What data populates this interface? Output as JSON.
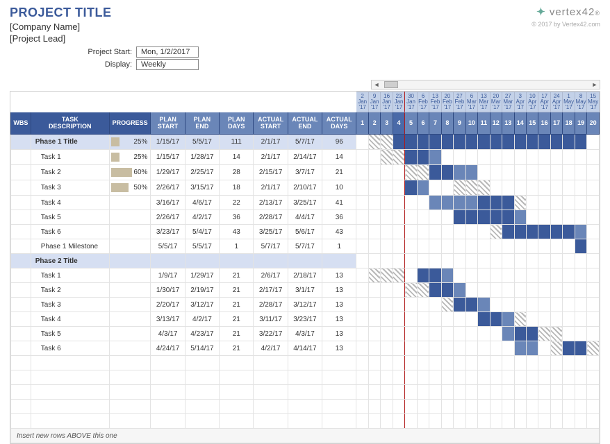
{
  "header": {
    "title": "PROJECT TITLE",
    "company": "[Company Name]",
    "lead": "[Project Lead]",
    "logo": "vertex42",
    "copyright": "© 2017 by Vertex42.com"
  },
  "controls": {
    "start_label": "Project Start:",
    "start_value": "Mon, 1/2/2017",
    "display_label": "Display:",
    "display_value": "Weekly"
  },
  "columns": {
    "wbs": "WBS",
    "task": "TASK DESCRIPTION",
    "progress": "PROGRESS",
    "pstart": "PLAN START",
    "pend": "PLAN END",
    "pdays": "PLAN DAYS",
    "astart": "ACTUAL START",
    "aend": "ACTUAL END",
    "adays": "ACTUAL DAYS"
  },
  "timeline_dates": [
    {
      "d": "2",
      "m": "Jan",
      "y": "'17"
    },
    {
      "d": "9",
      "m": "Jan",
      "y": "'17"
    },
    {
      "d": "16",
      "m": "Jan",
      "y": "'17"
    },
    {
      "d": "23",
      "m": "Jan",
      "y": "'17"
    },
    {
      "d": "30",
      "m": "Jan",
      "y": "'17"
    },
    {
      "d": "6",
      "m": "Feb",
      "y": "'17"
    },
    {
      "d": "13",
      "m": "Feb",
      "y": "'17"
    },
    {
      "d": "20",
      "m": "Feb",
      "y": "'17"
    },
    {
      "d": "27",
      "m": "Feb",
      "y": "'17"
    },
    {
      "d": "6",
      "m": "Mar",
      "y": "'17"
    },
    {
      "d": "13",
      "m": "Mar",
      "y": "'17"
    },
    {
      "d": "20",
      "m": "Mar",
      "y": "'17"
    },
    {
      "d": "27",
      "m": "Mar",
      "y": "'17"
    },
    {
      "d": "3",
      "m": "Apr",
      "y": "'17"
    },
    {
      "d": "10",
      "m": "Apr",
      "y": "'17"
    },
    {
      "d": "17",
      "m": "Apr",
      "y": "'17"
    },
    {
      "d": "24",
      "m": "Apr",
      "y": "'17"
    },
    {
      "d": "1",
      "m": "May",
      "y": "'17"
    },
    {
      "d": "8",
      "m": "May",
      "y": "'17"
    },
    {
      "d": "15",
      "m": "May",
      "y": "'17"
    }
  ],
  "timeline_numbers": [
    "1",
    "2",
    "3",
    "4",
    "5",
    "6",
    "7",
    "8",
    "9",
    "10",
    "11",
    "12",
    "13",
    "14",
    "15",
    "16",
    "17",
    "18",
    "19",
    "20"
  ],
  "today_week": 4,
  "rows": [
    {
      "type": "phase",
      "task": "Phase 1 Title",
      "progress": "25%",
      "prog_pct": 25,
      "ps": "1/15/17",
      "pe": "5/5/17",
      "pd": "111",
      "as": "2/1/17",
      "ae": "5/7/17",
      "ad": "96",
      "tl": [
        "",
        "s",
        "s",
        "b",
        "b",
        "b",
        "b",
        "b",
        "b",
        "b",
        "b",
        "b",
        "b",
        "b",
        "b",
        "b",
        "b",
        "b",
        "b",
        ""
      ]
    },
    {
      "type": "task",
      "task": "Task 1",
      "progress": "25%",
      "prog_pct": 25,
      "ps": "1/15/17",
      "pe": "1/28/17",
      "pd": "14",
      "as": "2/1/17",
      "ae": "2/14/17",
      "ad": "14",
      "tl": [
        "",
        "",
        "s",
        "s",
        "b",
        "b",
        "l",
        "",
        "",
        "",
        "",
        "",
        "",
        "",
        "",
        "",
        "",
        "",
        "",
        ""
      ]
    },
    {
      "type": "task",
      "task": "Task 2",
      "progress": "60%",
      "prog_pct": 60,
      "ps": "1/29/17",
      "pe": "2/25/17",
      "pd": "28",
      "as": "2/15/17",
      "ae": "3/7/17",
      "ad": "21",
      "tl": [
        "",
        "",
        "",
        "",
        "s",
        "s",
        "b",
        "b",
        "l",
        "l",
        "",
        "",
        "",
        "",
        "",
        "",
        "",
        "",
        "",
        ""
      ]
    },
    {
      "type": "task",
      "task": "Task 3",
      "progress": "50%",
      "prog_pct": 50,
      "ps": "2/26/17",
      "pe": "3/15/17",
      "pd": "18",
      "as": "2/1/17",
      "ae": "2/10/17",
      "ad": "10",
      "tl": [
        "",
        "",
        "",
        "",
        "b",
        "l",
        "",
        "",
        "s",
        "s",
        "s",
        "",
        "",
        "",
        "",
        "",
        "",
        "",
        "",
        ""
      ]
    },
    {
      "type": "task",
      "task": "Task 4",
      "progress": "",
      "prog_pct": 0,
      "ps": "3/16/17",
      "pe": "4/6/17",
      "pd": "22",
      "as": "2/13/17",
      "ae": "3/25/17",
      "ad": "41",
      "tl": [
        "",
        "",
        "",
        "",
        "",
        "",
        "l",
        "l",
        "l",
        "l",
        "b",
        "b",
        "b",
        "s",
        "",
        "",
        "",
        "",
        "",
        ""
      ]
    },
    {
      "type": "task",
      "task": "Task 5",
      "progress": "",
      "prog_pct": 0,
      "ps": "2/26/17",
      "pe": "4/2/17",
      "pd": "36",
      "as": "2/28/17",
      "ae": "4/4/17",
      "ad": "36",
      "tl": [
        "",
        "",
        "",
        "",
        "",
        "",
        "",
        "",
        "b",
        "b",
        "b",
        "b",
        "b",
        "l",
        "",
        "",
        "",
        "",
        "",
        ""
      ]
    },
    {
      "type": "task",
      "task": "Task 6",
      "progress": "",
      "prog_pct": 0,
      "ps": "3/23/17",
      "pe": "5/4/17",
      "pd": "43",
      "as": "3/25/17",
      "ae": "5/6/17",
      "ad": "43",
      "tl": [
        "",
        "",
        "",
        "",
        "",
        "",
        "",
        "",
        "",
        "",
        "",
        "s",
        "b",
        "b",
        "b",
        "b",
        "b",
        "b",
        "l",
        ""
      ]
    },
    {
      "type": "task",
      "task": "Phase 1 Milestone",
      "progress": "",
      "prog_pct": 0,
      "ps": "5/5/17",
      "pe": "5/5/17",
      "pd": "1",
      "as": "5/7/17",
      "ae": "5/7/17",
      "ad": "1",
      "tl": [
        "",
        "",
        "",
        "",
        "",
        "",
        "",
        "",
        "",
        "",
        "",
        "",
        "",
        "",
        "",
        "",
        "",
        "",
        "m",
        ""
      ]
    },
    {
      "type": "phase",
      "task": "Phase 2 Title",
      "progress": "",
      "prog_pct": 0,
      "ps": "",
      "pe": "",
      "pd": "",
      "as": "",
      "ae": "",
      "ad": "",
      "tl": [
        "",
        "",
        "",
        "",
        "",
        "",
        "",
        "",
        "",
        "",
        "",
        "",
        "",
        "",
        "",
        "",
        "",
        "",
        "",
        ""
      ]
    },
    {
      "type": "task",
      "task": "Task 1",
      "progress": "",
      "prog_pct": 0,
      "ps": "1/9/17",
      "pe": "1/29/17",
      "pd": "21",
      "as": "2/6/17",
      "ae": "2/18/17",
      "ad": "13",
      "tl": [
        "",
        "s",
        "s",
        "s",
        "",
        "b",
        "b",
        "l",
        "",
        "",
        "",
        "",
        "",
        "",
        "",
        "",
        "",
        "",
        "",
        ""
      ]
    },
    {
      "type": "task",
      "task": "Task 2",
      "progress": "",
      "prog_pct": 0,
      "ps": "1/30/17",
      "pe": "2/19/17",
      "pd": "21",
      "as": "2/17/17",
      "ae": "3/1/17",
      "ad": "13",
      "tl": [
        "",
        "",
        "",
        "",
        "s",
        "s",
        "b",
        "b",
        "l",
        "",
        "",
        "",
        "",
        "",
        "",
        "",
        "",
        "",
        "",
        ""
      ]
    },
    {
      "type": "task",
      "task": "Task 3",
      "progress": "",
      "prog_pct": 0,
      "ps": "2/20/17",
      "pe": "3/12/17",
      "pd": "21",
      "as": "2/28/17",
      "ae": "3/12/17",
      "ad": "13",
      "tl": [
        "",
        "",
        "",
        "",
        "",
        "",
        "",
        "s",
        "b",
        "b",
        "l",
        "",
        "",
        "",
        "",
        "",
        "",
        "",
        "",
        ""
      ]
    },
    {
      "type": "task",
      "task": "Task 4",
      "progress": "",
      "prog_pct": 0,
      "ps": "3/13/17",
      "pe": "4/2/17",
      "pd": "21",
      "as": "3/11/17",
      "ae": "3/23/17",
      "ad": "13",
      "tl": [
        "",
        "",
        "",
        "",
        "",
        "",
        "",
        "",
        "",
        "",
        "b",
        "b",
        "l",
        "s",
        "",
        "",
        "",
        "",
        "",
        ""
      ]
    },
    {
      "type": "task",
      "task": "Task 5",
      "progress": "",
      "prog_pct": 0,
      "ps": "4/3/17",
      "pe": "4/23/17",
      "pd": "21",
      "as": "3/22/17",
      "ae": "4/3/17",
      "ad": "13",
      "tl": [
        "",
        "",
        "",
        "",
        "",
        "",
        "",
        "",
        "",
        "",
        "",
        "",
        "l",
        "b",
        "b",
        "s",
        "s",
        "",
        "",
        ""
      ]
    },
    {
      "type": "task",
      "task": "Task 6",
      "progress": "",
      "prog_pct": 0,
      "ps": "4/24/17",
      "pe": "5/14/17",
      "pd": "21",
      "as": "4/2/17",
      "ae": "4/14/17",
      "ad": "13",
      "tl": [
        "",
        "",
        "",
        "",
        "",
        "",
        "",
        "",
        "",
        "",
        "",
        "",
        "",
        "l",
        "l",
        "",
        "s",
        "b",
        "b",
        "s"
      ]
    }
  ],
  "blank_rows": 5,
  "hint": "Insert new rows ABOVE this one"
}
